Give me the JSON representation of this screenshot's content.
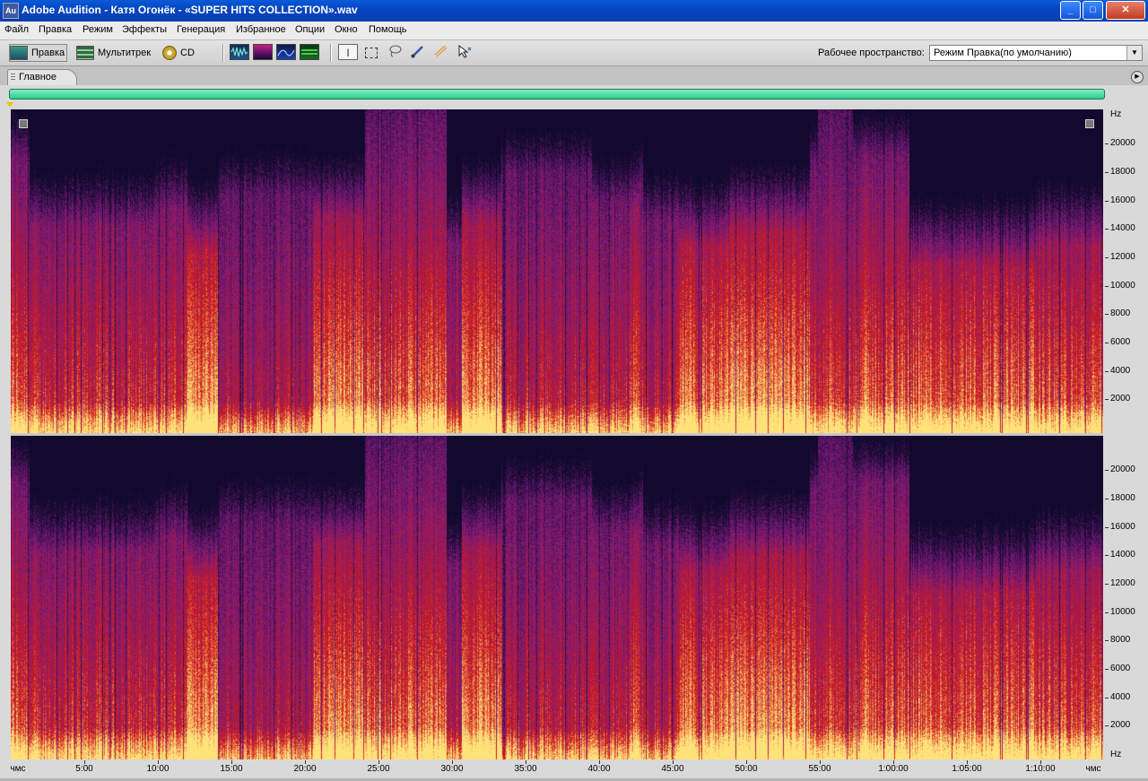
{
  "window": {
    "app_icon": "Au",
    "title": "Adobe Audition - Катя Огонёк - «SUPER HITS COLLECTION».wav"
  },
  "menu": [
    "Файл",
    "Правка",
    "Режим",
    "Эффекты",
    "Генерация",
    "Избранное",
    "Опции",
    "Окно",
    "Помощь"
  ],
  "toolbar": {
    "modes": [
      {
        "icon": "waveform-edit-icon",
        "label": "Правка"
      },
      {
        "icon": "multitrack-icon",
        "label": "Мультитрек"
      },
      {
        "icon": "cd-icon",
        "label": "CD"
      }
    ],
    "views": [
      "waveform-view-icon",
      "spectral-frequency-view-icon",
      "spectral-pan-view-icon",
      "spectral-phase-view-icon"
    ],
    "tools": [
      "time-selection-tool-icon",
      "marquee-selection-tool-icon",
      "lasso-selection-tool-icon",
      "effects-paintbrush-tool-icon",
      "spot-healing-brush-tool-icon",
      "scrub-tool-icon"
    ],
    "workspace_label": "Рабочее пространство:",
    "workspace_value": "Режим Правка(по умолчанию)"
  },
  "panel": {
    "tab_label": "Главное"
  },
  "spectrogram": {
    "colors": {
      "low": "#120a2e",
      "mid": "#7a1a7a",
      "high": "#d11b1b",
      "peak": "#ffe27a"
    },
    "freq_unit": "Hz",
    "freq_ticks": [
      20000,
      18000,
      16000,
      14000,
      12000,
      10000,
      8000,
      6000,
      4000,
      2000
    ],
    "freq_max": 22050,
    "time_start_label": "чмс",
    "time_end_label": "чмс",
    "time_ticks": [
      "5:00",
      "10:00",
      "15:00",
      "20:00",
      "25:00",
      "30:00",
      "35:00",
      "40:00",
      "45:00",
      "50:00",
      "55:00",
      "1:00:00",
      "1:05:00",
      "1:10:00"
    ],
    "tick_interval_min": 5,
    "duration_min": 74.3
  }
}
